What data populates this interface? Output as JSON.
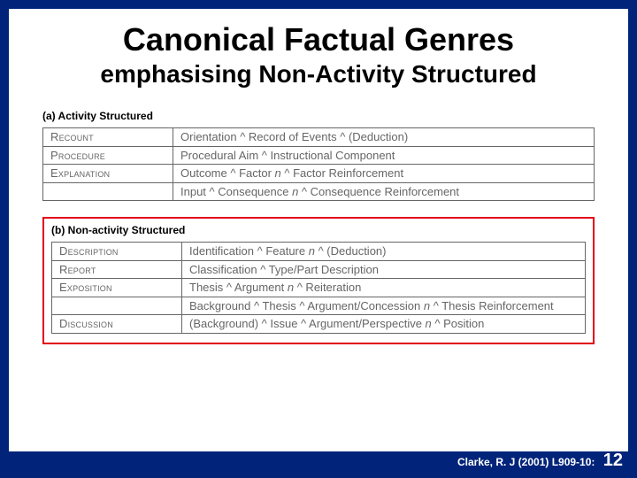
{
  "title": {
    "main": "Canonical Factual Genres",
    "sub": "emphasising Non-Activity Structured"
  },
  "section_a": {
    "label": "(a) Activity Structured",
    "rows": [
      {
        "genre": "Recount",
        "stages": "Orientation ^ Record of Events ^ (Deduction)"
      },
      {
        "genre": "Procedure",
        "stages": "Procedural Aim ^ Instructional Component"
      },
      {
        "genre": "Explanation",
        "stages_a": "Outcome ^ Factor ",
        "n": "n",
        "stages_b": " ^ Factor Reinforcement"
      },
      {
        "genre": "",
        "stages_a": "Input ^ Consequence ",
        "n": "n",
        "stages_b": " ^ Consequence Reinforcement"
      }
    ]
  },
  "section_b": {
    "label": "(b) Non-activity Structured",
    "rows": [
      {
        "genre": "Description",
        "stages_a": "Identification ^ Feature ",
        "n": "n",
        "stages_b": " ^ (Deduction)"
      },
      {
        "genre": "Report",
        "stages": "Classification ^ Type/Part Description"
      },
      {
        "genre": "Exposition",
        "stages_a": "Thesis ^ Argument ",
        "n": "n",
        "stages_b": " ^ Reiteration"
      },
      {
        "genre": "",
        "stages_a": "Background ^ Thesis ^ Argument/Concession ",
        "n": "n",
        "stages_b": " ^ Thesis Reinforcement"
      },
      {
        "genre": "Discussion",
        "stages_a": "(Background) ^ Issue ^ Argument/Perspective ",
        "n": "n",
        "stages_b": " ^ Position"
      }
    ]
  },
  "footer": {
    "cite": "Clarke, R. J (2001) L909-10:",
    "page": "12"
  }
}
